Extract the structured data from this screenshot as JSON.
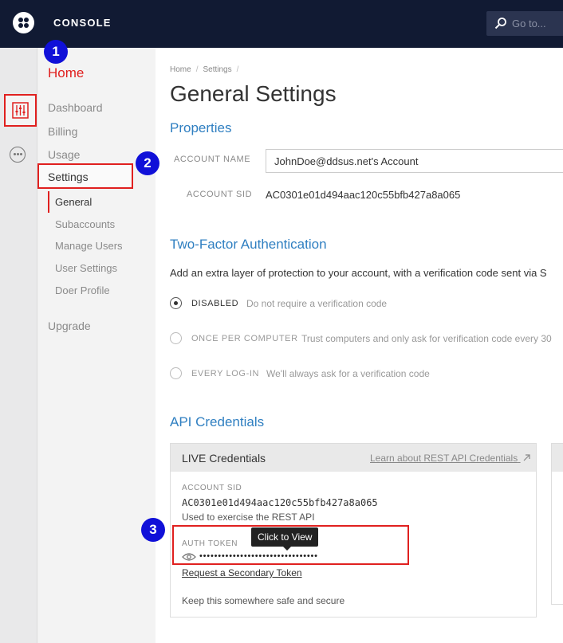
{
  "topbar": {
    "title": "CONSOLE",
    "search_placeholder": "Go to..."
  },
  "nav": {
    "home": "Home",
    "items": [
      "Dashboard",
      "Billing",
      "Usage",
      "Settings"
    ],
    "sub_items": [
      "General",
      "Subaccounts",
      "Manage Users",
      "User Settings",
      "Doer Profile"
    ],
    "upgrade": "Upgrade"
  },
  "badges": [
    "1",
    "2",
    "3"
  ],
  "main": {
    "breadcrumb": [
      "Home",
      "Settings"
    ],
    "title": "General Settings",
    "properties": {
      "heading": "Properties",
      "account_name_label": "ACCOUNT NAME",
      "account_name_value": "JohnDoe@ddsus.net's Account",
      "account_sid_label": "ACCOUNT SID",
      "account_sid_value": "AC0301e01d494aac120c55bfb427a8a065"
    },
    "two_factor": {
      "heading": "Two-Factor Authentication",
      "description": "Add an extra layer of protection to your account, with a verification code sent via S",
      "options": [
        {
          "label": "DISABLED",
          "desc": "Do not require a verification code"
        },
        {
          "label": "ONCE PER COMPUTER",
          "desc": "Trust computers and only ask for verification code every 30"
        },
        {
          "label": "EVERY LOG-IN",
          "desc": "We'll always ask for a verification code"
        }
      ]
    },
    "api": {
      "heading": "API Credentials",
      "card_title": "LIVE Credentials",
      "learn_link": "Learn about REST API Credentials",
      "sid_label": "ACCOUNT SID",
      "sid_value": "AC0301e01d494aac120c55bfb427a8a065",
      "sid_desc": "Used to exercise the REST API",
      "auth_label": "AUTH TOKEN",
      "tooltip": "Click to View",
      "token_mask": "••••••••••••••••••••••••••••••••",
      "secondary_link": "Request a Secondary Token",
      "safe_note": "Keep this somewhere safe and secure"
    }
  },
  "colors": {
    "topbar": "#111a33",
    "accent_red": "#e0201f",
    "link_blue": "#2f7fc1",
    "badge_blue": "#1010d8"
  }
}
